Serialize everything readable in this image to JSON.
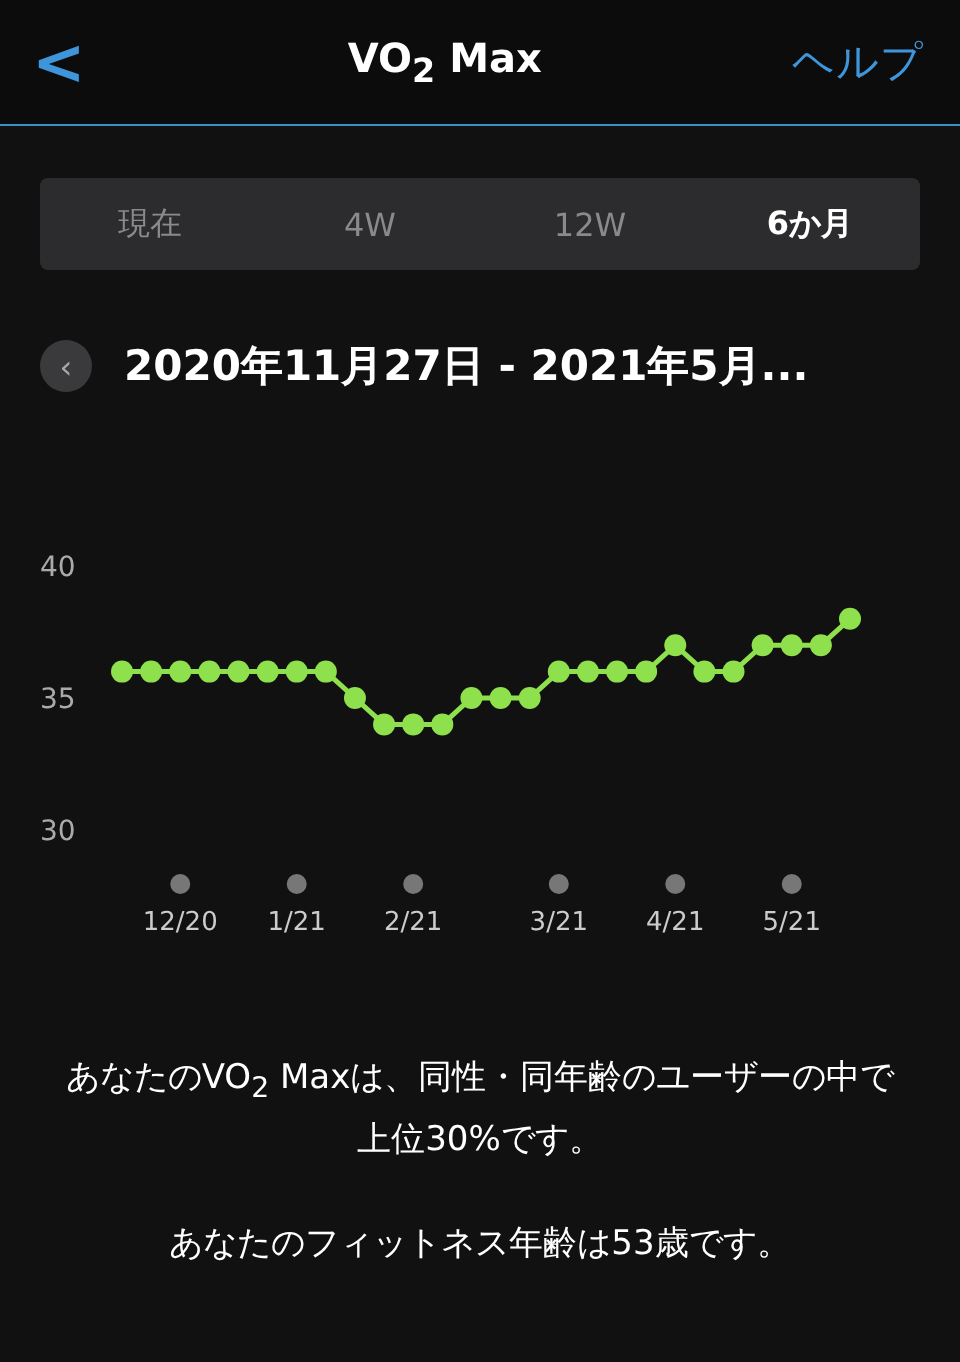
{
  "header": {
    "back": "<",
    "title": "VO$_{2}$ Max",
    "help": "ヘルプ"
  },
  "tabs": [
    {
      "label": "現在",
      "selected": false
    },
    {
      "label": "4W",
      "selected": false
    },
    {
      "label": "12W",
      "selected": false
    },
    {
      "label": "6か月",
      "selected": true
    }
  ],
  "period": {
    "prev": "‹",
    "range": "2020年11月27日 - 2021年5月..."
  },
  "chart": {
    "chart_data": {
      "type": "line",
      "categories": [
        null,
        null,
        "12/20",
        null,
        null,
        null,
        "1/21",
        null,
        null,
        null,
        "2/21",
        null,
        null,
        null,
        null,
        "3/21",
        null,
        null,
        null,
        "4/21",
        null,
        null,
        null,
        "5/21",
        null,
        null
      ],
      "series": [
        {
          "color": "#8ee04c",
          "marker": "circle",
          "values": [
            36,
            36,
            36,
            36,
            36,
            36,
            36,
            36,
            35,
            34,
            34,
            34,
            35,
            35,
            35,
            36,
            36,
            36,
            36,
            37,
            36,
            36,
            37,
            37,
            37,
            38
          ]
        }
      ],
      "ylim": [
        30,
        40
      ],
      "yticks": [
        30,
        35,
        40
      ]
    }
  },
  "summary": [
    "あなたのVO$_{2}$ Maxは、同性・同年齢のユーザーの中で上位30%です。",
    "あなたのフィットネス年齢は53歳です。"
  ]
}
